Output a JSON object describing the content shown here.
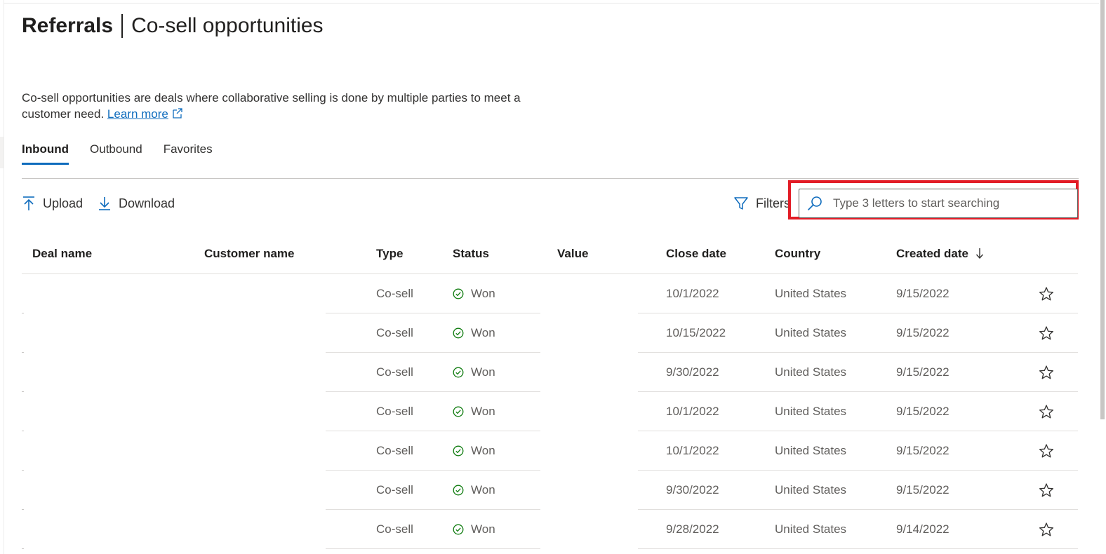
{
  "header": {
    "title": "Referrals",
    "subtitle": "Co-sell opportunities"
  },
  "description": {
    "text": "Co-sell opportunities are deals where collaborative selling is done by multiple parties to meet a customer need.",
    "link_label": "Learn more"
  },
  "tabs": [
    {
      "label": "Inbound",
      "active": true
    },
    {
      "label": "Outbound",
      "active": false
    },
    {
      "label": "Favorites",
      "active": false
    }
  ],
  "toolbar": {
    "upload_label": "Upload",
    "download_label": "Download",
    "filters_label": "Filters",
    "search_placeholder": "Type 3 letters to start searching"
  },
  "table": {
    "columns": [
      "Deal name",
      "Customer name",
      "Type",
      "Status",
      "Value",
      "Close date",
      "Country",
      "Created date"
    ],
    "sorted_column": "Created date",
    "sort_direction": "descending",
    "rows": [
      {
        "deal_name": "",
        "customer_name": "",
        "type": "Co-sell",
        "status": "Won",
        "value": "",
        "close_date": "10/1/2022",
        "country": "United States",
        "created_date": "9/15/2022"
      },
      {
        "deal_name": "",
        "customer_name": "",
        "type": "Co-sell",
        "status": "Won",
        "value": "",
        "close_date": "10/15/2022",
        "country": "United States",
        "created_date": "9/15/2022"
      },
      {
        "deal_name": "",
        "customer_name": "",
        "type": "Co-sell",
        "status": "Won",
        "value": "",
        "close_date": "9/30/2022",
        "country": "United States",
        "created_date": "9/15/2022"
      },
      {
        "deal_name": "",
        "customer_name": "",
        "type": "Co-sell",
        "status": "Won",
        "value": "",
        "close_date": "10/1/2022",
        "country": "United States",
        "created_date": "9/15/2022"
      },
      {
        "deal_name": "",
        "customer_name": "",
        "type": "Co-sell",
        "status": "Won",
        "value": "",
        "close_date": "10/1/2022",
        "country": "United States",
        "created_date": "9/15/2022"
      },
      {
        "deal_name": "",
        "customer_name": "",
        "type": "Co-sell",
        "status": "Won",
        "value": "",
        "close_date": "9/30/2022",
        "country": "United States",
        "created_date": "9/15/2022"
      },
      {
        "deal_name": "",
        "customer_name": "",
        "type": "Co-sell",
        "status": "Won",
        "value": "",
        "close_date": "9/28/2022",
        "country": "United States",
        "created_date": "9/14/2022"
      }
    ]
  },
  "icons": {
    "upload": "arrow-up-icon",
    "download": "arrow-down-icon",
    "filter": "funnel-icon",
    "search": "search-icon",
    "status_won": "check-circle-icon",
    "favorite": "star-outline-icon",
    "external_link": "external-link-icon",
    "sort": "arrow-down-sort-icon"
  },
  "colors": {
    "accent": "#0f6cbd",
    "won": "#107c10",
    "highlight": "#e21c26"
  }
}
